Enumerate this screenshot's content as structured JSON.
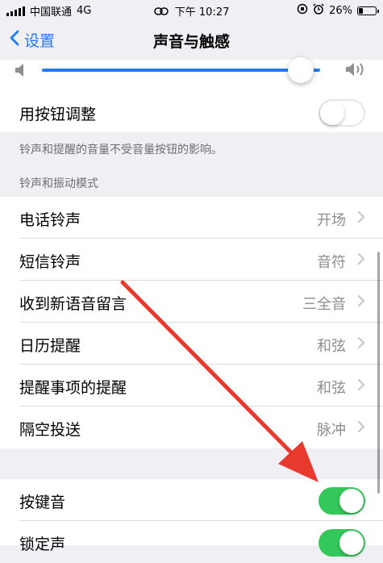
{
  "status_bar": {
    "carrier": "中国联通",
    "network": "4G",
    "time": "下午 10:27",
    "battery": "26%",
    "battery_level": 0.26
  },
  "nav": {
    "back_label": "设置",
    "title": "声音与触感"
  },
  "volume": {
    "level": 0.93
  },
  "button_adjust": {
    "label": "用按钮调整",
    "on": false,
    "note": "铃声和提醒的音量不受音量按钮的影响。"
  },
  "sounds_section": {
    "header": "铃声和振动模式",
    "items": [
      {
        "label": "电话铃声",
        "value": "开场"
      },
      {
        "label": "短信铃声",
        "value": "音符"
      },
      {
        "label": "收到新语音留言",
        "value": "三全音"
      },
      {
        "label": "日历提醒",
        "value": "和弦"
      },
      {
        "label": "提醒事项的提醒",
        "value": "和弦"
      },
      {
        "label": "隔空投送",
        "value": "脉冲"
      }
    ]
  },
  "toggles_section": {
    "items": [
      {
        "label": "按键音",
        "on": true
      },
      {
        "label": "锁定声",
        "on": true
      }
    ]
  },
  "colors": {
    "accent": "#1f7cf6",
    "toggle_on": "#34c759",
    "annotation_arrow": "#e8392f"
  }
}
